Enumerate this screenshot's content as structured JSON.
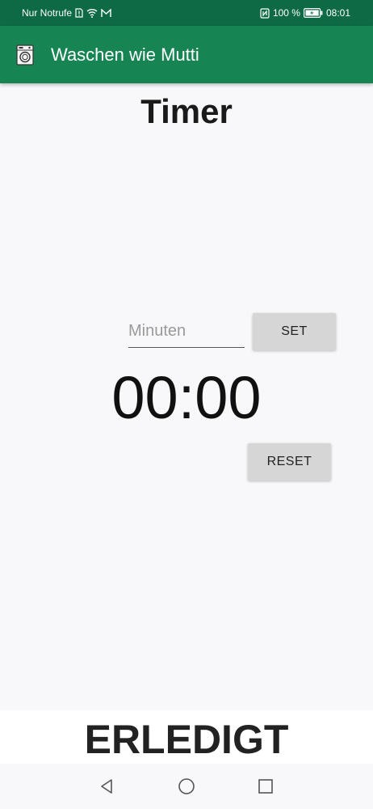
{
  "status_bar": {
    "carrier": "Nur Notrufe",
    "battery": "100 %",
    "time": "08:01",
    "icons": [
      "sim-alert-icon",
      "wifi-icon",
      "mail-icon",
      "nfc-icon",
      "battery-icon"
    ]
  },
  "app_bar": {
    "title": "Waschen wie Mutti",
    "icon": "washing-machine-icon",
    "background": "#178453"
  },
  "main": {
    "title": "Timer",
    "minutes_input": {
      "value": "",
      "placeholder": "Minuten"
    },
    "set_label": "SET",
    "timer_value": "00:00",
    "reset_label": "RESET",
    "done_label": "ERLEDIGT"
  },
  "nav_bar": {
    "buttons": [
      "back-icon",
      "home-icon",
      "recents-icon"
    ]
  }
}
